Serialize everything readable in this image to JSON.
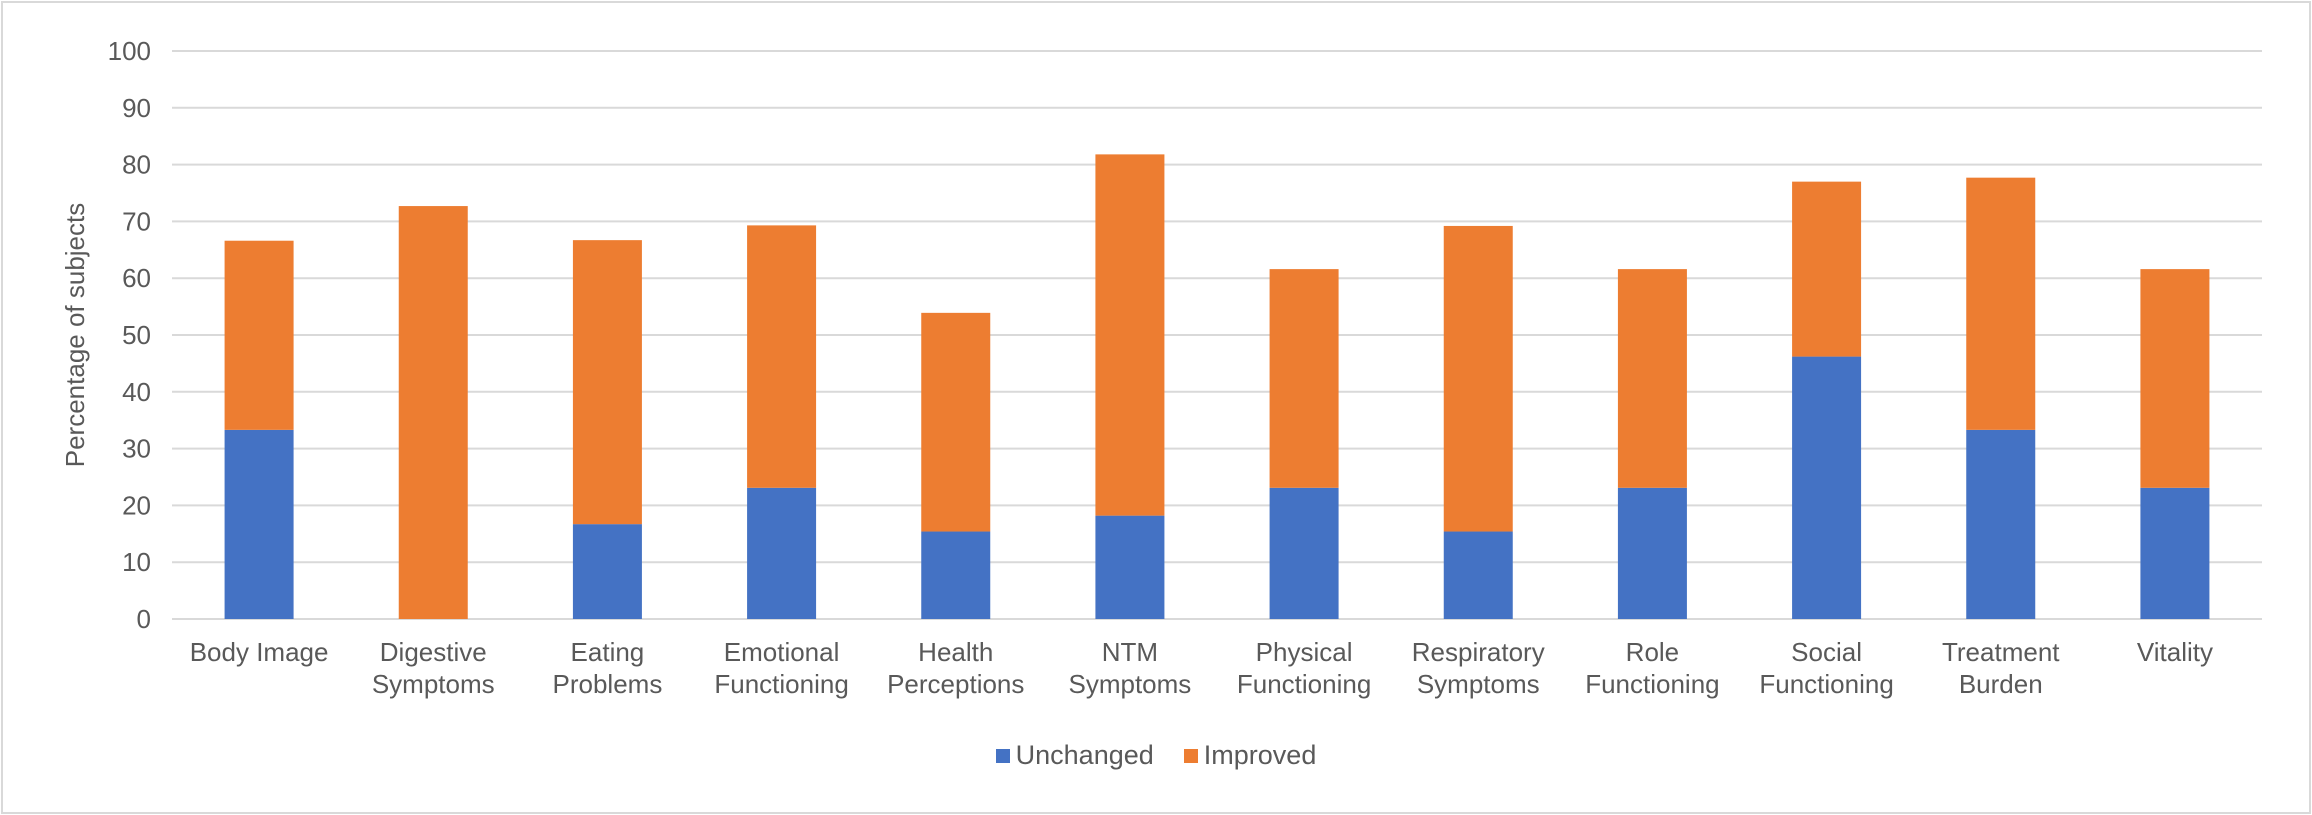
{
  "chart_data": {
    "type": "bar",
    "stacked": true,
    "title": "",
    "xlabel": "",
    "ylabel": "Percentage of subjects",
    "ylim": [
      0,
      100
    ],
    "yticks": [
      0,
      10,
      20,
      30,
      40,
      50,
      60,
      70,
      80,
      90,
      100
    ],
    "grid": true,
    "legend_position": "bottom",
    "categories": [
      [
        "Body Image"
      ],
      [
        "Digestive",
        "Symptoms"
      ],
      [
        "Eating",
        "Problems"
      ],
      [
        "Emotional",
        "Functioning"
      ],
      [
        "Health",
        "Perceptions"
      ],
      [
        "NTM",
        "Symptoms"
      ],
      [
        "Physical",
        "Functioning"
      ],
      [
        "Respiratory",
        "Symptoms"
      ],
      [
        "Role",
        "Functioning"
      ],
      [
        "Social",
        "Functioning"
      ],
      [
        "Treatment",
        "Burden"
      ],
      [
        "Vitality"
      ]
    ],
    "series": [
      {
        "name": "Unchanged",
        "color": "#4472c4",
        "values": [
          33.3,
          0,
          16.7,
          23.1,
          15.4,
          18.2,
          23.1,
          15.4,
          23.1,
          46.2,
          33.3,
          23.1
        ]
      },
      {
        "name": "Improved",
        "color": "#ed7d31",
        "values": [
          33.3,
          72.7,
          50.0,
          46.2,
          38.5,
          63.6,
          38.5,
          53.8,
          38.5,
          30.8,
          44.4,
          38.5
        ]
      }
    ]
  }
}
